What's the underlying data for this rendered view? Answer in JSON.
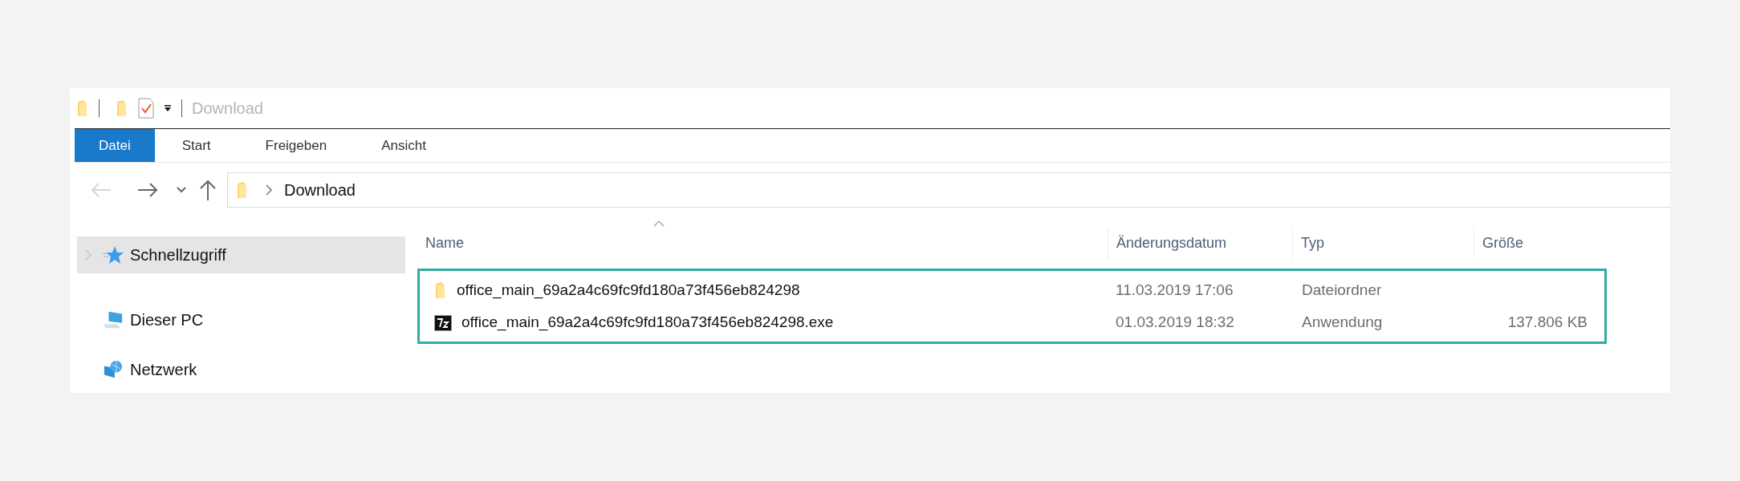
{
  "window": {
    "title": "Download"
  },
  "ribbon_tabs": [
    {
      "label": "Datei",
      "selected": true
    },
    {
      "label": "Start",
      "selected": false
    },
    {
      "label": "Freigeben",
      "selected": false
    },
    {
      "label": "Ansicht",
      "selected": false
    }
  ],
  "navigation": {
    "back_disabled": true,
    "forward_disabled": false
  },
  "address_bar": {
    "path": [
      "Download"
    ]
  },
  "sidebar": {
    "items": [
      {
        "label": "Schnellzugriff",
        "kind": "star",
        "selected": true
      },
      {
        "label": "Dieser PC",
        "kind": "computer",
        "selected": false
      },
      {
        "label": "Netzwerk",
        "kind": "network",
        "selected": false
      }
    ]
  },
  "table": {
    "columns": [
      "Name",
      "Änderungsdatum",
      "Typ",
      "Größe"
    ],
    "rows": [
      {
        "kind": "folder",
        "name": "office_main_69a2a4c69fc9fd180a73f456eb824298",
        "date": "11.03.2019 17:06",
        "type": "Dateiordner"
      },
      {
        "kind": "archive",
        "name": "office_main_69a2a4c69fc9fd180a73f456eb824298.exe",
        "date": "01.03.2019 18:32",
        "type": "Anwendung",
        "size": "137.806 KB"
      }
    ]
  }
}
